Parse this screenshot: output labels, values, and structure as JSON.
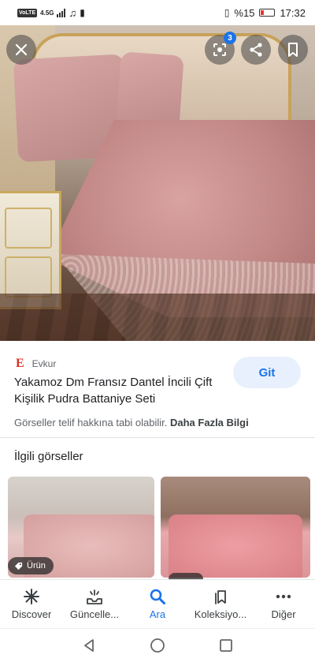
{
  "status_bar": {
    "carrier": "VoLTE",
    "network": "4.5G",
    "battery_text": "%15",
    "time": "17:32"
  },
  "hero": {
    "lens_badge": "3"
  },
  "result": {
    "source": "Evkur",
    "source_logo": "E",
    "title": "Yakamoz Dm Fransız Dantel İncili Çift Kişilik Pudra Battaniye Seti",
    "go_label": "Git",
    "copyright_text": "Görseller telif hakkına tabi olabilir.",
    "more_info": "Daha Fazla Bilgi"
  },
  "related": {
    "title": "İlgili görseller",
    "product_tag": "Ürün"
  },
  "bottom_nav": {
    "items": [
      {
        "label": "Discover",
        "icon": "asterisk-icon"
      },
      {
        "label": "Güncelle...",
        "icon": "updates-icon"
      },
      {
        "label": "Ara",
        "icon": "search-icon"
      },
      {
        "label": "Koleksiyo...",
        "icon": "collections-icon"
      },
      {
        "label": "Diğer",
        "icon": "more-icon"
      }
    ],
    "active_index": 2
  },
  "colors": {
    "accent": "#1a73e8",
    "go_bg": "#e8f0fe",
    "source_logo": "#d93025"
  }
}
